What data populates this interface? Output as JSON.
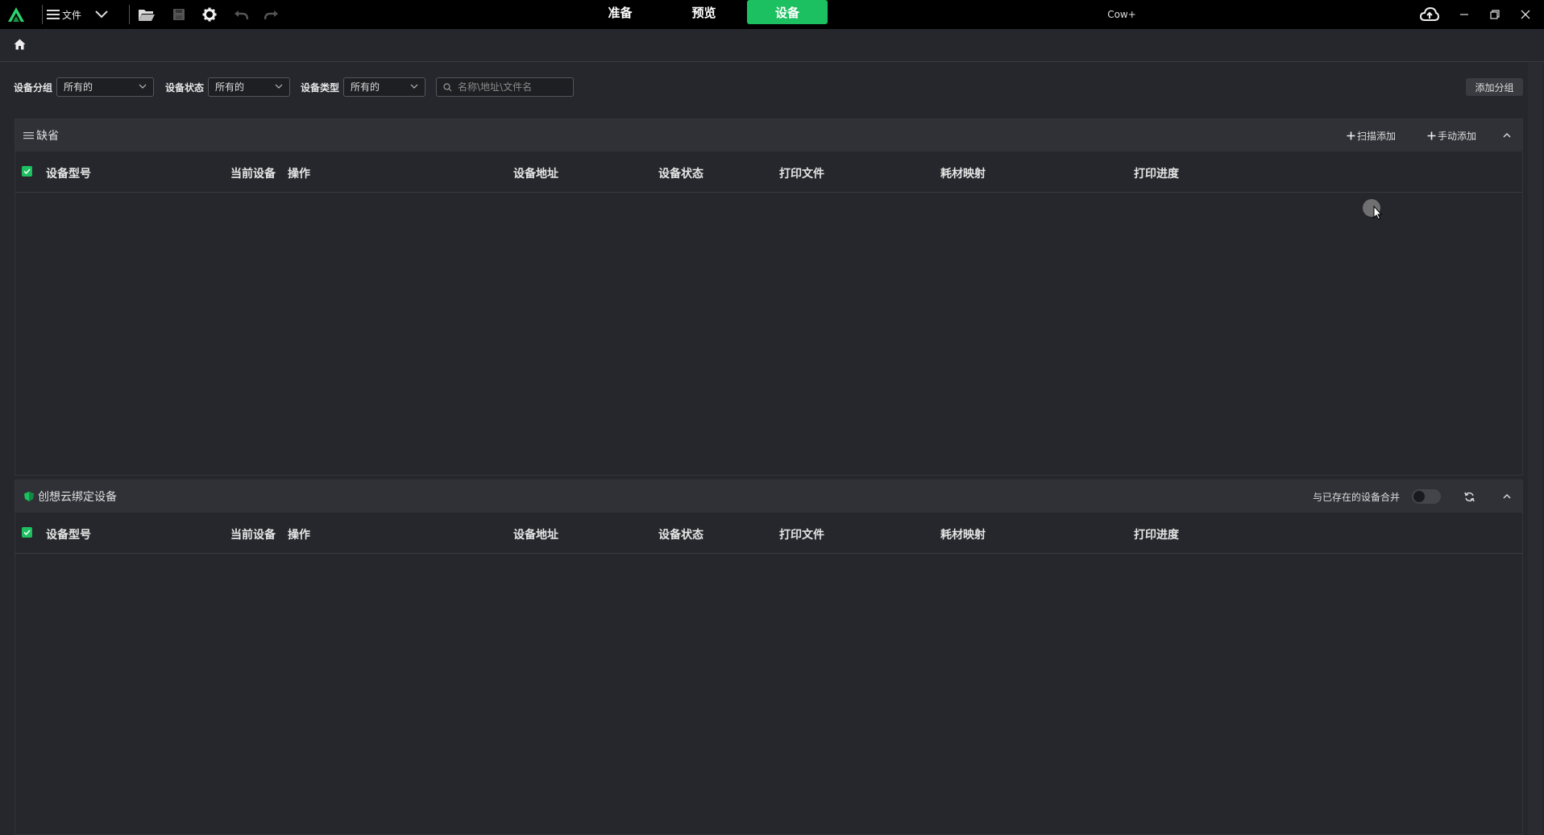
{
  "app": {
    "title": "Cow+",
    "menu_label": "文件",
    "tabs": [
      {
        "label": "准备",
        "active": false
      },
      {
        "label": "预览",
        "active": false
      },
      {
        "label": "设备",
        "active": true
      }
    ],
    "accent_color": "#1cc060"
  },
  "filters": {
    "group_label": "设备分组",
    "group_value": "所有的",
    "status_label": "设备状态",
    "status_value": "所有的",
    "type_label": "设备类型",
    "type_value": "所有的",
    "search_placeholder": "名称\\地址\\文件名",
    "add_group_label": "添加分组"
  },
  "panel_default": {
    "title": "缺省",
    "scan_add_label": "扫描添加",
    "manual_add_label": "手动添加",
    "columns": [
      "设备型号",
      "当前设备",
      "操作",
      "设备地址",
      "设备状态",
      "打印文件",
      "耗材映射",
      "打印进度"
    ]
  },
  "panel_cloud": {
    "title": "创想云绑定设备",
    "merge_label": "与已存在的设备合并",
    "merge_enabled": false,
    "columns": [
      "设备型号",
      "当前设备",
      "操作",
      "设备地址",
      "设备状态",
      "打印文件",
      "耗材映射",
      "打印进度"
    ]
  }
}
